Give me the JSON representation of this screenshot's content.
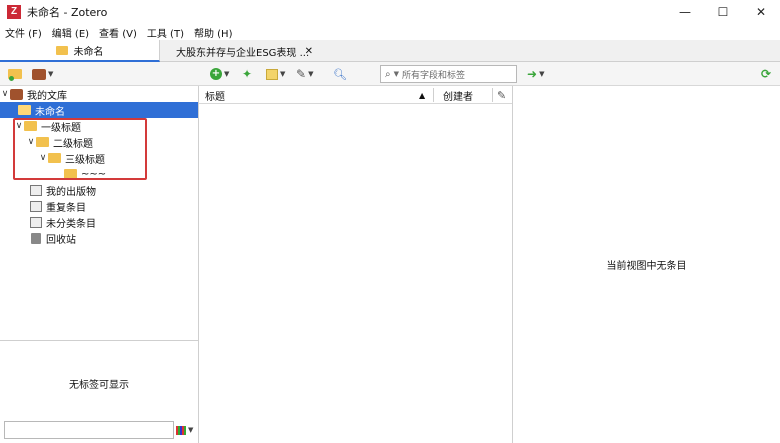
{
  "window": {
    "title": "未命名 - Zotero",
    "app_icon_letter": "Z",
    "controls": {
      "minimize": "—",
      "maximize": "☐",
      "close": "✕"
    }
  },
  "menu": [
    "文件 (F)",
    "编辑 (E)",
    "查看 (V)",
    "工具 (T)",
    "帮助 (H)"
  ],
  "tabs": {
    "active": "未命名",
    "other": "大股东并存与企业ESG表现 ...",
    "close": "✕"
  },
  "toolbar": {
    "search_placeholder": "所有字段和标签",
    "icons": [
      "new-collection-icon",
      "new-library-icon",
      "new-item-icon",
      "add-by-identifier-icon",
      "new-note-icon",
      "add-attachment-icon",
      "advanced-search-icon",
      "locate-icon",
      "sync-icon"
    ]
  },
  "tree": {
    "library": "我的文库",
    "unnamed": "未命名",
    "level1": "一级标题",
    "level2": "二级标题",
    "level3": "三级标题",
    "level4": "~~~",
    "publications": "我的出版物",
    "duplicates": "重复条目",
    "unfiled": "未分类条目",
    "trash": "回收站",
    "twist_open": "∨"
  },
  "tags": {
    "empty": "无标签可显示"
  },
  "items": {
    "columns": [
      "标题",
      "创建者"
    ],
    "sort_indicator": "▲"
  },
  "item_pane": {
    "empty": "当前视图中无条目"
  },
  "colors": {
    "selection": "#2f6fd6",
    "folder": "#f2c14e",
    "annotation_box": "#d33a3a",
    "zotero_red": "#cc2936"
  }
}
